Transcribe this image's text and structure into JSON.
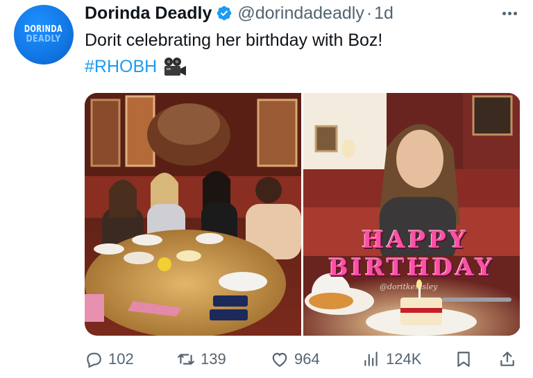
{
  "tweet": {
    "avatar": {
      "line1": "DORINDA",
      "line2": "DEADLY"
    },
    "author_name": "Dorinda Deadly",
    "handle": "@dorindadeadly",
    "separator": "·",
    "age": "1d",
    "text": "Dorit celebrating her birthday with Boz!",
    "hashtag": "#RHOBH",
    "hashtag_emoji": "movie-camera-icon",
    "colors": {
      "link": "#1d9bf0",
      "verified": "#1d9bf0",
      "secondary": "#536471"
    }
  },
  "media": {
    "left_photo": "group-dinner-photo",
    "right_photo": {
      "overlay_line1": "HAPPY",
      "overlay_line2": "BIRTHDAY",
      "credit": "@doritkemsley"
    }
  },
  "actions": {
    "replies": "102",
    "retweets": "139",
    "likes": "964",
    "views": "124K"
  }
}
